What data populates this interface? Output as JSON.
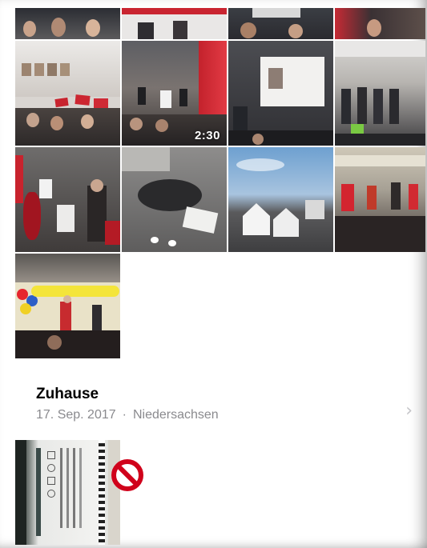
{
  "photos": {
    "video_duration": "2:30"
  },
  "moment": {
    "title": "Zuhause",
    "date": "17. Sep. 2017",
    "separator": "·",
    "location": "Niedersachsen",
    "disclosure_icon": "chevron-right-icon"
  },
  "badge": {
    "icon": "prohibited-icon",
    "color": "#d0021b"
  }
}
